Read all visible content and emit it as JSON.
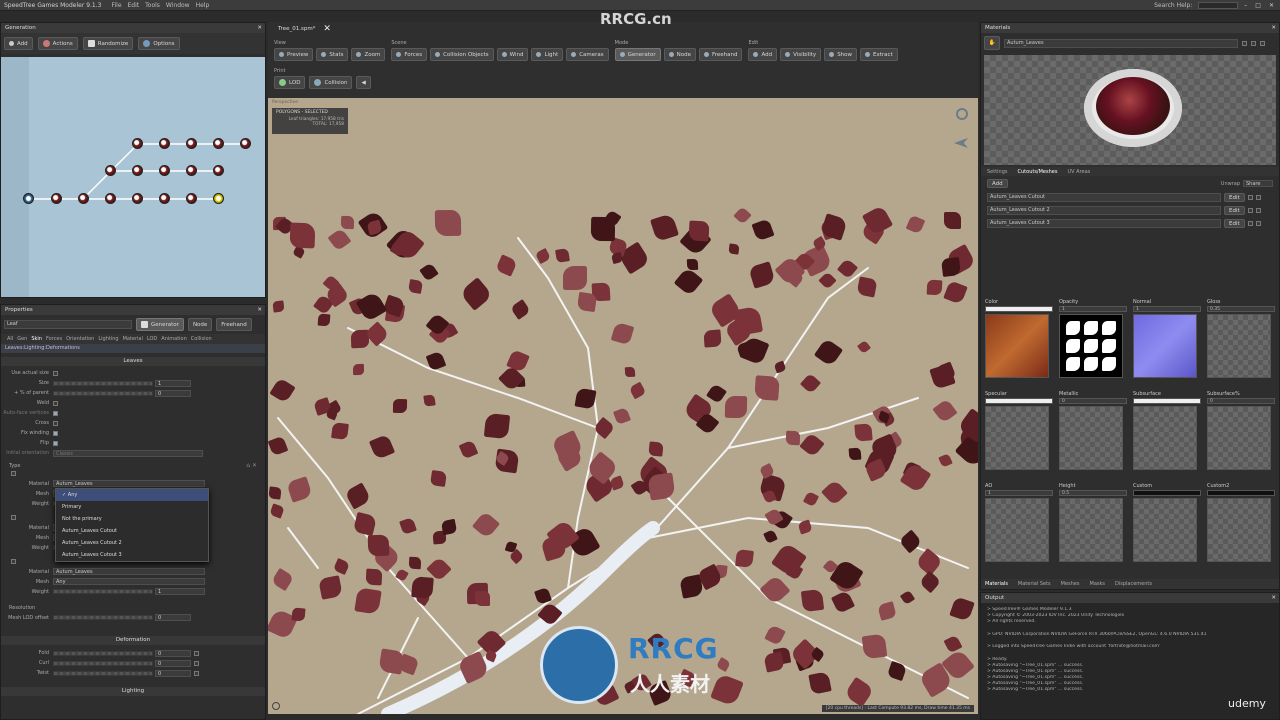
{
  "app": {
    "title": "SpeedTree Games Modeler 9.1.3",
    "menu": [
      "File",
      "Edit",
      "Tools",
      "Window",
      "Help"
    ],
    "search_help": "Search Help:",
    "document_tab": "Tree_01.spm*"
  },
  "generation": {
    "title": "Generation",
    "buttons": [
      "Add",
      "Actions",
      "Randomize",
      "Options"
    ]
  },
  "toolbar": {
    "groups": [
      {
        "label": "View",
        "buttons": [
          "Preview",
          "Stats",
          "Zoom"
        ]
      },
      {
        "label": "Scene",
        "buttons": [
          "Forces",
          "Collision Objects",
          "Wind",
          "Light",
          "Cameras"
        ]
      },
      {
        "label": "Mode",
        "buttons": [
          "Generator",
          "Node",
          "Freehand"
        ]
      },
      {
        "label": "Edit",
        "buttons": [
          "Add",
          "Visibility",
          "Show",
          "Extract"
        ]
      }
    ],
    "print_label": "Print",
    "print_buttons": [
      "LOD",
      "Collision"
    ]
  },
  "viewport": {
    "label": "Perspective",
    "polygons_header": "POLYGONS - SELECTED",
    "leaf_triangles": "Leaf triangles: 17,958 tris",
    "total": "TOTAL: 17,958",
    "status": "[20 cpu threads] : Last Compute 93.82 ms, Draw time 41.35 ms"
  },
  "properties": {
    "title": "Properties",
    "object_name": "Leaf",
    "mode_buttons": [
      "Generator",
      "Node",
      "Freehand"
    ],
    "tabs": [
      "All",
      "Gen",
      "Skin",
      "Forces",
      "Orientation",
      "Lighting",
      "Material",
      "LOD",
      "Animation",
      "Collision"
    ],
    "section_path": "Leaves:Lighting:Deformations",
    "leaves_header": "Leaves",
    "rows": [
      {
        "label": "Use actual size",
        "kind": "check",
        "on": false
      },
      {
        "label": "Size",
        "kind": "slider",
        "value": "1"
      },
      {
        "label": "+ % of parent",
        "kind": "slider",
        "value": "0"
      },
      {
        "label": "Weld",
        "kind": "check",
        "on": false
      },
      {
        "label": "Auto-face vertices",
        "kind": "check",
        "on": true
      },
      {
        "label": "Cross",
        "kind": "check",
        "on": false
      },
      {
        "label": "Fix winding",
        "kind": "check",
        "on": true
      },
      {
        "label": "Flip",
        "kind": "check",
        "on": true
      },
      {
        "label": "Initial orientation",
        "kind": "text",
        "value": "Classic"
      }
    ],
    "type_header": "Type",
    "type_rows": [
      {
        "material_label": "Material",
        "material_value": "Autum_Leaves",
        "mesh_label": "Mesh",
        "weight_label": "Weight"
      },
      {
        "material_label": "Material",
        "mesh_label": "Mesh",
        "weight_label": "Weight"
      },
      {
        "material_label": "Material",
        "material_value": "Autum_Leaves",
        "mesh_label": "Mesh",
        "mesh_value": "Any",
        "weight_label": "Weight",
        "weight_value": "1"
      }
    ],
    "dropdown": [
      "Any",
      "Primary",
      "Not the primary",
      "Autum_Leaves Cutout",
      "Autum_Leaves Cutout 2",
      "Autum_Leaves Cutout 3"
    ],
    "resolution_header": "Resolution",
    "resolution_row": {
      "label": "Mesh LOD offset",
      "value": "0"
    },
    "deformation_header": "Deformation",
    "deform_rows": [
      {
        "label": "Fold",
        "value": "0"
      },
      {
        "label": "Curl",
        "value": "0"
      },
      {
        "label": "Twist",
        "value": "0"
      }
    ],
    "lighting_header": "Lighting"
  },
  "materials": {
    "title": "Materials",
    "selected": "Autum_Leaves",
    "subtabs": [
      "Settings",
      "Cutouts/Meshes",
      "UV Areas"
    ],
    "add_label": "Add",
    "unwrap_label": "Unwrap",
    "unwrap_value": "Share",
    "cutouts": [
      "Autum_Leaves Cutout",
      "Autum_Leaves Cutout 2",
      "Autum_Leaves Cutout 3"
    ],
    "edit_label": "Edit",
    "slots_row1": [
      {
        "name": "Color",
        "value": ""
      },
      {
        "name": "Opacity",
        "value": "1"
      },
      {
        "name": "Normal",
        "value": "1"
      },
      {
        "name": "Gloss",
        "value": "0.35"
      }
    ],
    "slots_row2": [
      {
        "name": "Specular",
        "value": ""
      },
      {
        "name": "Metallic",
        "value": "0"
      },
      {
        "name": "Subsurface",
        "value": ""
      },
      {
        "name": "Subsurface%",
        "value": "0"
      }
    ],
    "slots_row3": [
      {
        "name": "AO",
        "value": "1"
      },
      {
        "name": "Height",
        "value": "0.5"
      },
      {
        "name": "Custom",
        "value": ""
      },
      {
        "name": "Custom2",
        "value": ""
      }
    ],
    "bottom_tabs": [
      "Materials",
      "Material Sets",
      "Meshes",
      "Masks",
      "Displacements"
    ]
  },
  "output": {
    "title": "Output",
    "lines": [
      "> SpeedTree® Games Modeler 9.1.3",
      "> Copyright © 2003-2023 IDV Inc. 2023 Unity Technologies",
      "> All rights reserved.",
      "",
      "> GPU: NVIDIA Corporation NVIDIA GeForce RTX 3060/PCIe/SSE2, OpenGL: 4.6.0 NVIDIA 531.41",
      "",
      "> Logged into SpeedTree Games Indie with account 'fortnite@hotmail.com'",
      "",
      "> Ready.",
      "> Autosaving \"~Tree_01.spm\" ... success.",
      "> Autosaving \"~Tree_01.spm\" ... success.",
      "> Autosaving \"~Tree_01.spm\" ... success.",
      "> Autosaving \"~Tree_01.spm\" ... success.",
      "> Autosaving \"~Tree_01.spm\" ... success."
    ]
  },
  "watermark": {
    "site": "RRCG.cn",
    "brand": "RRCG",
    "brand_cn": "人人素材",
    "udemy": "udemy"
  },
  "colors": {
    "bg": "#2b2b2b",
    "panel": "#2e2e2e",
    "viewport": "#b5a78e",
    "graph_bg": "#a9c4d4",
    "leaf": "#6e2a30"
  }
}
